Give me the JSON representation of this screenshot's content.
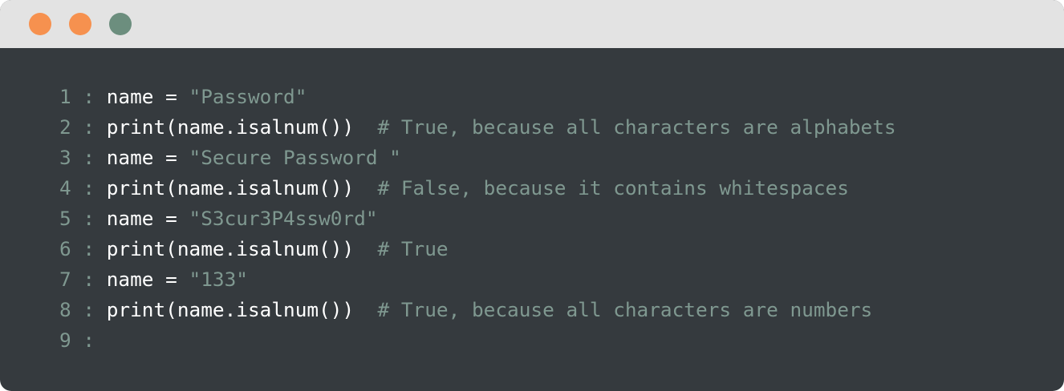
{
  "window": {
    "dot_colors": [
      "#f6914f",
      "#f6914f",
      "#6c8e7e"
    ]
  },
  "colors": {
    "background": "#353a3e",
    "titlebar": "#e3e3e3",
    "code_text": "#ffffff",
    "line_number": "#7f9890",
    "string": "#7f9890",
    "comment": "#7f9890"
  },
  "lines": [
    {
      "number": "1",
      "separator": " : ",
      "code": "name = ",
      "string": "\"Password\"",
      "comment": ""
    },
    {
      "number": "2",
      "separator": " : ",
      "code": "print(name.isalnum())  ",
      "string": "",
      "comment": "# True, because all characters are alphabets"
    },
    {
      "number": "3",
      "separator": " : ",
      "code": "name = ",
      "string": "\"Secure Password \"",
      "comment": ""
    },
    {
      "number": "4",
      "separator": " : ",
      "code": "print(name.isalnum())  ",
      "string": "",
      "comment": "# False, because it contains whitespaces"
    },
    {
      "number": "5",
      "separator": " : ",
      "code": "name = ",
      "string": "\"S3cur3P4ssw0rd\"",
      "comment": ""
    },
    {
      "number": "6",
      "separator": " : ",
      "code": "print(name.isalnum())  ",
      "string": "",
      "comment": "# True"
    },
    {
      "number": "7",
      "separator": " : ",
      "code": "name = ",
      "string": "\"133\"",
      "comment": ""
    },
    {
      "number": "8",
      "separator": " : ",
      "code": "print(name.isalnum())  ",
      "string": "",
      "comment": "# True, because all characters are numbers"
    },
    {
      "number": "9",
      "separator": " :",
      "code": "",
      "string": "",
      "comment": ""
    }
  ]
}
